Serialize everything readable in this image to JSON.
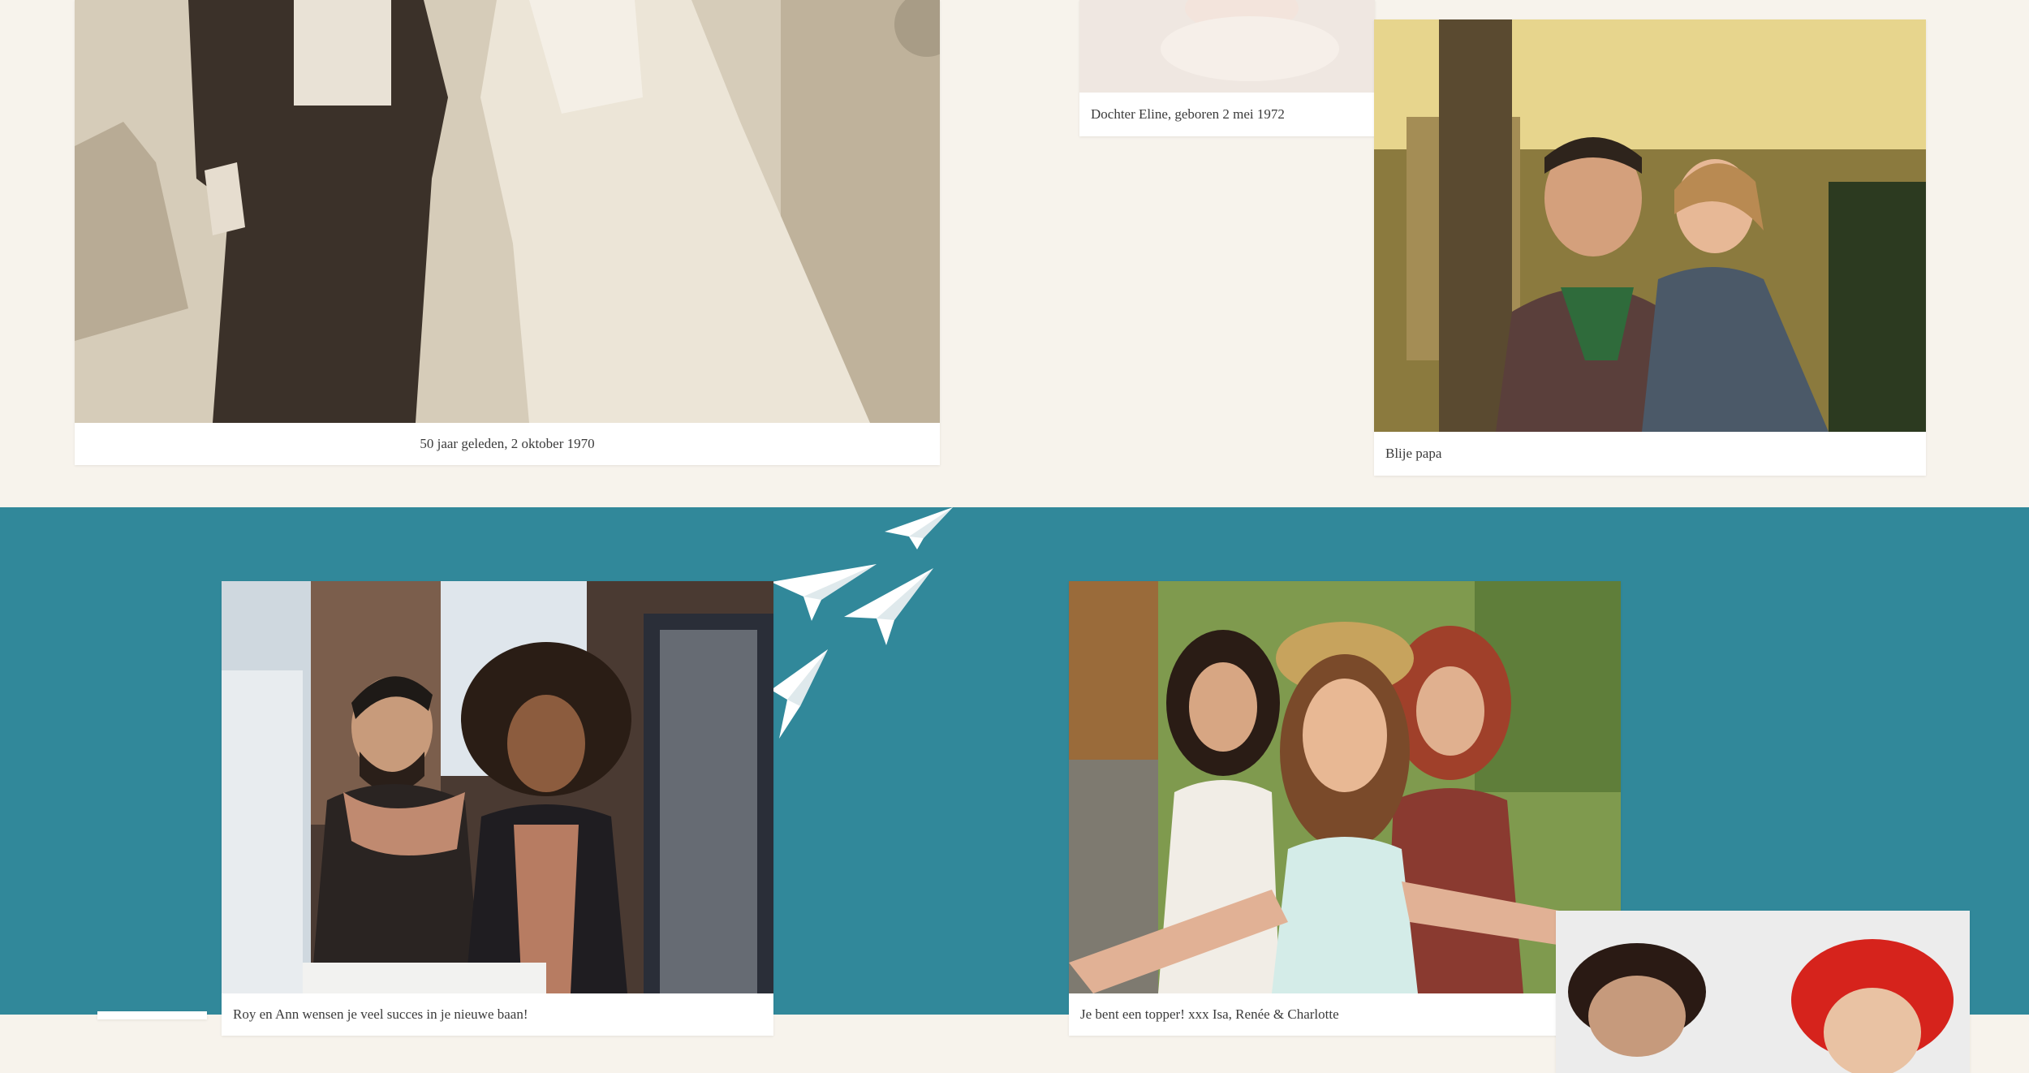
{
  "colors": {
    "top_background": "#f7f3ec",
    "bottom_background": "#31889a",
    "frame": "#ffffff",
    "caption_text": "#3b3b3b"
  },
  "photos": {
    "wedding": {
      "caption": "50 jaar geleden, 2 oktober 1970"
    },
    "baby": {
      "caption": "Dochter Eline, geboren 2 mei 1972"
    },
    "dad": {
      "caption": "Blije papa"
    },
    "office": {
      "caption": "Roy en Ann wensen je veel succes in je nieuwe baan!"
    },
    "friends": {
      "caption": "Je bent een topper! xxx Isa, Renée & Charlotte"
    },
    "red_hair": {
      "caption": ""
    }
  },
  "decorations": {
    "paper_planes": "paper-plane-icon"
  }
}
